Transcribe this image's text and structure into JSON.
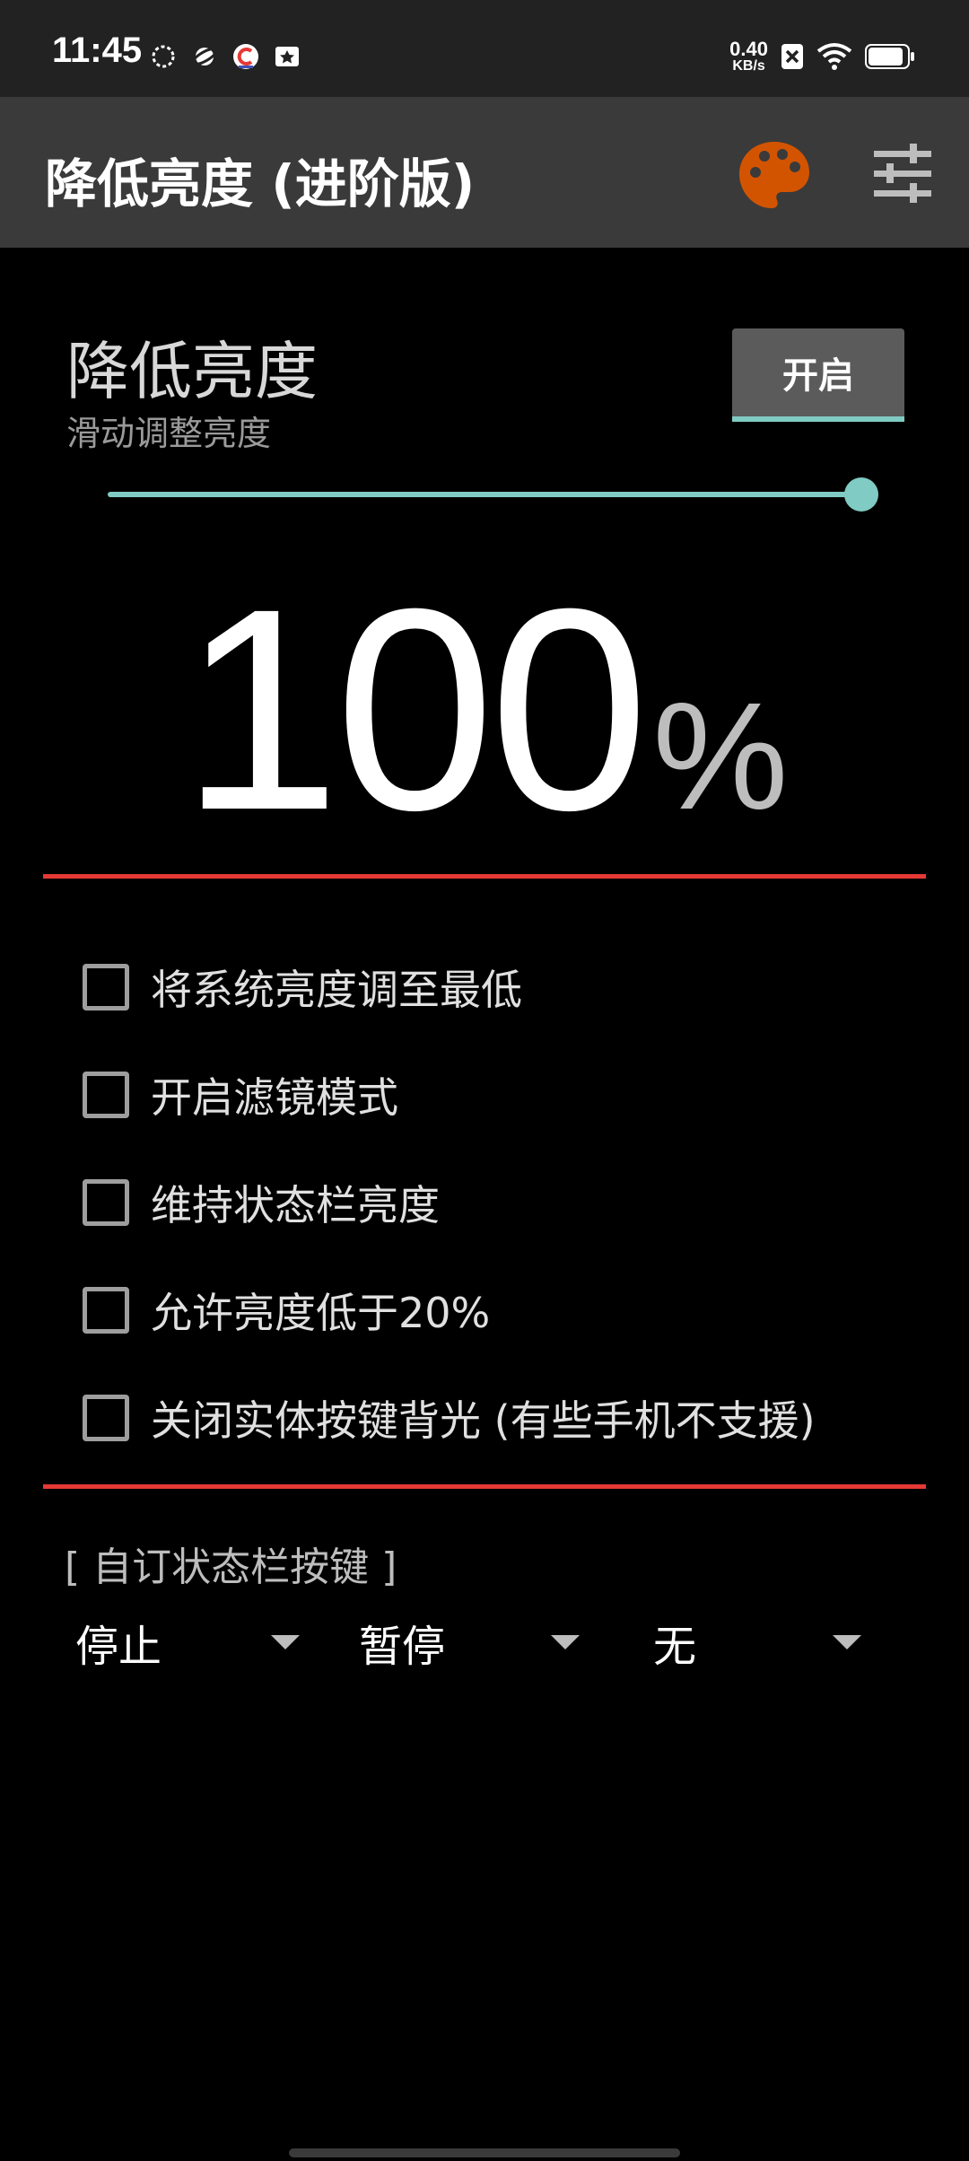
{
  "status_bar": {
    "time": "11:45",
    "net_speed_value": "0.40",
    "net_speed_unit": "KB/s",
    "icons": [
      "loading-circle-icon",
      "planet-icon",
      "app-c-icon",
      "star-card-icon",
      "close-box-icon",
      "wifi-icon",
      "battery-icon"
    ]
  },
  "app_bar": {
    "title": "降低亮度 (进阶版)",
    "palette_icon_color": "#d35400"
  },
  "header": {
    "title": "降低亮度",
    "subtitle": "滑动调整亮度",
    "toggle_label": "开启"
  },
  "slider": {
    "value_percent": 100,
    "accent": "#80cbc4"
  },
  "display": {
    "value": "100",
    "unit": "%"
  },
  "divider_color": "#e53935",
  "options": [
    {
      "label": "将系统亮度调至最低",
      "checked": false
    },
    {
      "label": "开启滤镜模式",
      "checked": false
    },
    {
      "label": "维持状态栏亮度",
      "checked": false
    },
    {
      "label": "允许亮度低于20%",
      "checked": false
    },
    {
      "label": "关闭实体按键背光 (有些手机不支援)",
      "checked": false
    }
  ],
  "custom_keys": {
    "title": "[ 自订状态栏按键 ]",
    "spinners": [
      {
        "value": "停止"
      },
      {
        "value": "暂停"
      },
      {
        "value": "无"
      }
    ]
  }
}
